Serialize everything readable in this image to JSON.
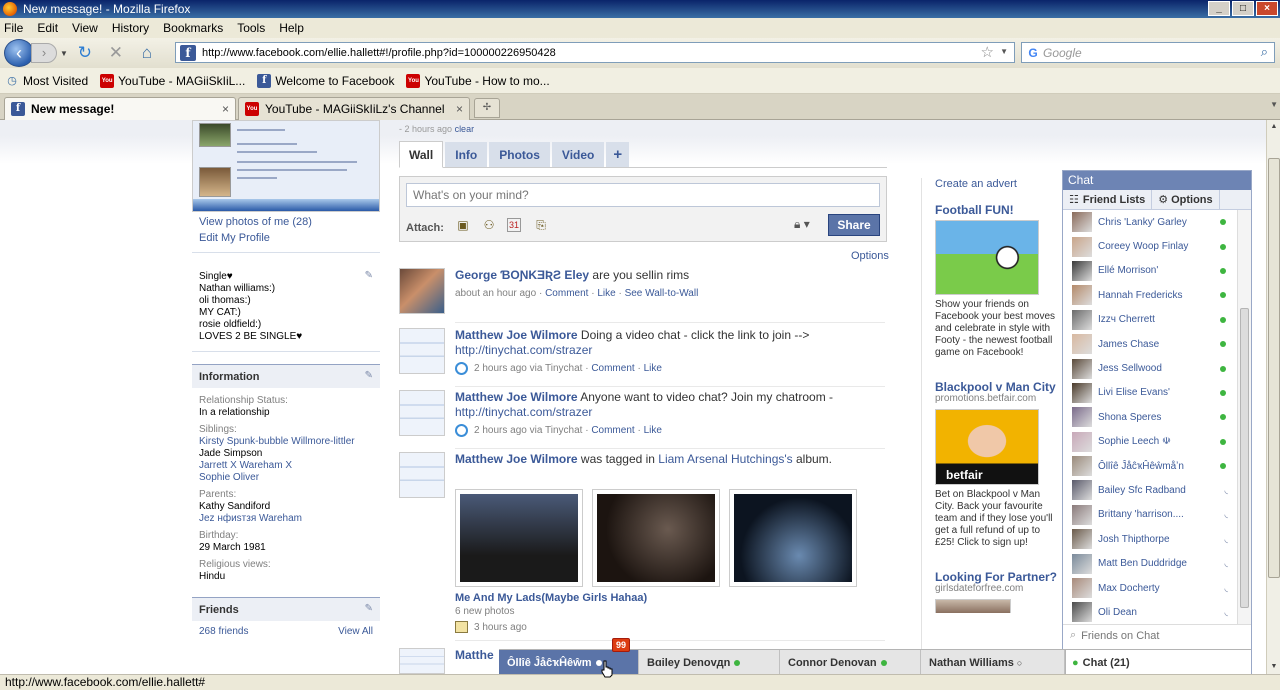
{
  "window": {
    "title": "New message! - Mozilla Firefox"
  },
  "menu": [
    "File",
    "Edit",
    "View",
    "History",
    "Bookmarks",
    "Tools",
    "Help"
  ],
  "url": "http://www.facebook.com/ellie.hallett#!/profile.php?id=100000226950428",
  "search_placeholder": "Google",
  "bookmarks": [
    {
      "label": "Most Visited",
      "icon": "most-visited-icon"
    },
    {
      "label": "YouTube - MAGiiSkIiL...",
      "icon": "youtube-icon"
    },
    {
      "label": "Welcome to Facebook",
      "icon": "facebook-icon"
    },
    {
      "label": "YouTube - How to mo...",
      "icon": "youtube-icon"
    }
  ],
  "tabs": [
    {
      "label": "New message!",
      "active": true,
      "icon": "facebook-icon"
    },
    {
      "label": "YouTube - MAGiiSkIiLz's Channel",
      "active": false,
      "icon": "youtube-icon"
    }
  ],
  "left": {
    "view_photos": "View photos of me (28)",
    "edit_profile": "Edit My Profile",
    "bio": [
      "Single♥",
      "Nathan williams:)",
      "oli thomas:)",
      "MY CAT:)",
      "rosie oldfield:)",
      "LOVES 2 BE SINGLE♥"
    ],
    "info_title": "Information",
    "relationship_label": "Relationship Status:",
    "relationship_value": "In a relationship",
    "siblings_label": "Siblings:",
    "siblings": [
      {
        "name": "Kirsty Spunk-bubble Willmore-littler",
        "link": true
      },
      {
        "name": "Jade Simpson",
        "link": false
      },
      {
        "name": "Jarrett X Wareham X",
        "link": true
      },
      {
        "name": "Sophie Oliver",
        "link": true
      }
    ],
    "parents_label": "Parents:",
    "parents": [
      {
        "name": "Kathy Sandiford",
        "link": false
      },
      {
        "name": "Jez нфиsтзя Wareham",
        "link": true
      }
    ],
    "birthday_label": "Birthday:",
    "birthday_value": "29 March 1981",
    "religion_label": "Religious views:",
    "religion_value": "Hindu",
    "friends_title": "Friends",
    "friends_count": "268 friends",
    "view_all": "View All"
  },
  "profile": {
    "recent": "- 2 hours ago",
    "clear": "clear",
    "tabs": [
      "Wall",
      "Info",
      "Photos",
      "Video",
      "+"
    ],
    "composer_placeholder": "What's on your mind?",
    "attach_label": "Attach:",
    "share_label": "Share",
    "options_label": "Options"
  },
  "stories": [
    {
      "name": "George ƁOƝKƎƦƧ Eley",
      "text": " are you sellin rims",
      "link": "",
      "meta_time": "about an hour ago",
      "meta_via": "",
      "actions": [
        "Comment",
        "Like",
        "See Wall-to-Wall"
      ]
    },
    {
      "name": "Matthew Joe Wilmore",
      "text": " Doing a video chat - click the link to join -->",
      "link": "http://tinychat.com/strazer",
      "meta_time": "2 hours ago",
      "meta_via": "via Tinychat",
      "actions": [
        "Comment",
        "Like"
      ]
    },
    {
      "name": "Matthew Joe Wilmore",
      "text": " Anyone want to video chat? Join my chatroom - ",
      "link": "http://tinychat.com/strazer",
      "meta_time": "2 hours ago",
      "meta_via": "via Tinychat",
      "actions": [
        "Comment",
        "Like"
      ]
    },
    {
      "name": "Matthew Joe Wilmore",
      "text": " was tagged in ",
      "tag_link": "Liam Arsenal Hutchings's",
      "text2": " album.",
      "album_title": "Me And My Lads(Maybe Girls Hahaa)",
      "album_count": "6 new photos",
      "meta_time": "3 hours ago"
    },
    {
      "name": "Matthe"
    }
  ],
  "ads": {
    "create": "Create an advert",
    "ad1_title": "Football FUN!",
    "ad1_text": "Show your friends on Facebook your best moves and celebrate in style with Footy - the newest football game on Facebook!",
    "ad2_title": "Blackpool v Man City",
    "ad2_domain": "promotions.betfair.com",
    "ad2_brand": "betfair",
    "ad2_text": "Bet on Blackpool v Man City. Back your favourite team and if they lose you'll get a full refund of up to £25! Click to sign up!",
    "ad3_title": "Looking For Partner?",
    "ad3_domain": "girlsdateforfree.com"
  },
  "chat": {
    "title": "Chat",
    "friend_lists": "Friend Lists",
    "options": "Options",
    "friends": [
      {
        "name": "Chris 'Lanky' Garley",
        "status": "online"
      },
      {
        "name": "Coreey Woop Finlay",
        "status": "online"
      },
      {
        "name": "Ellé Morrison'",
        "status": "online"
      },
      {
        "name": "Hannah Fredericks",
        "status": "online"
      },
      {
        "name": "Izzч Cherrett",
        "status": "online"
      },
      {
        "name": "James Chase",
        "status": "online"
      },
      {
        "name": "Jess Sellwood",
        "status": "online"
      },
      {
        "name": "Livi Elise Evans'",
        "status": "online"
      },
      {
        "name": "Shona Speres",
        "status": "online"
      },
      {
        "name": "Sophie Leech ☫",
        "status": "online"
      },
      {
        "name": "Ôllîê ĴåĉҡĤêŵmåʼn",
        "status": "online"
      },
      {
        "name": "Bailey Sfc Radband",
        "status": "idle"
      },
      {
        "name": "Brittany 'harrison....",
        "status": "idle"
      },
      {
        "name": "Josh Thipthorpe",
        "status": "idle"
      },
      {
        "name": "Matt Ben Duddridge",
        "status": "idle"
      },
      {
        "name": "Max Docherty",
        "status": "idle"
      },
      {
        "name": "Oli Dean",
        "status": "idle"
      }
    ],
    "search_placeholder": "Friends on Chat",
    "bar_label": "Chat (21)"
  },
  "chatbar": [
    {
      "name": "Ôllîê ĴåĉҡĤêŵm",
      "active": true
    },
    {
      "name": "Bɑiley Denovдn",
      "active": false
    },
    {
      "name": "Connor Denovan",
      "active": false
    },
    {
      "name": "Nathan Williams",
      "active": false
    }
  ],
  "chatbar_badge": "99",
  "status_url": "http://www.facebook.com/ellie.hallett#",
  "colors": {
    "facebook_blue": "#3b5998",
    "chat_header": "#6d84b4",
    "online_green": "#3eb540",
    "badge_red": "#dd3c10"
  }
}
